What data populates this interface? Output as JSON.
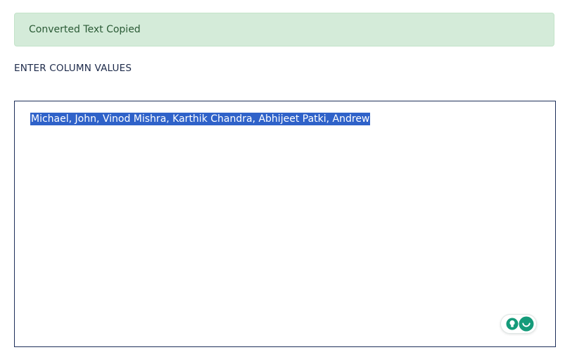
{
  "alert": {
    "message": "Converted Text Copied",
    "color": "#d4ebd9"
  },
  "column_values": {
    "label": "ENTER COLUMN VALUES",
    "value": "Michael, John, Vinod Mishra, Karthik Chandra, Abhijeet Patki, Andrew",
    "selected": true
  },
  "assistant_widget": {
    "icons": [
      "lightbulb-icon",
      "grammarly-icon"
    ],
    "accent": "#159b7a"
  }
}
